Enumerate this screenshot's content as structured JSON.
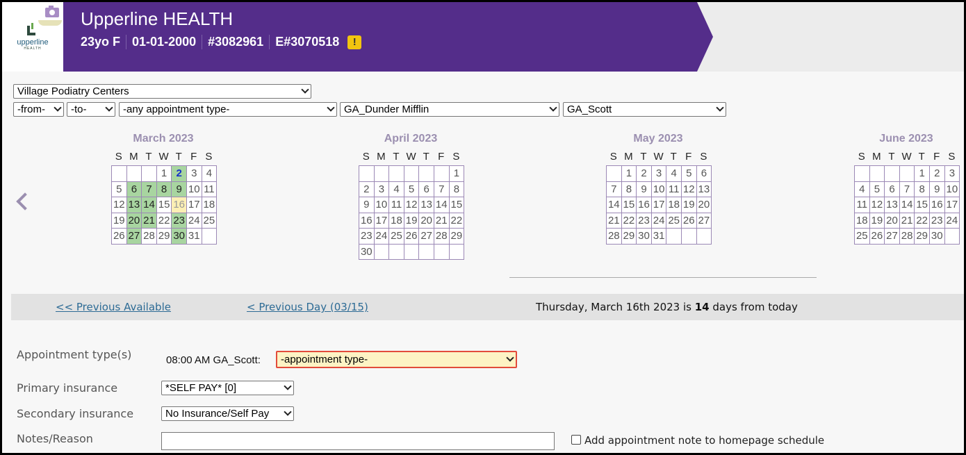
{
  "header": {
    "logo_text": "upperline",
    "logo_sub": "HEALTH",
    "title": "Upperline HEALTH",
    "patient": {
      "age_sex": "23yo F",
      "dob": "01-01-2000",
      "mrn": "#3082961",
      "enterprise_id": "E#3070518",
      "alert": "!"
    }
  },
  "filters": {
    "practice": "Village Podiatry Centers",
    "from": "-from-",
    "to": "-to-",
    "appointment_type": "-any appointment type-",
    "department": "GA_Dunder Mifflin",
    "provider": "GA_Scott"
  },
  "calendar": {
    "dow": [
      "S",
      "M",
      "T",
      "W",
      "T",
      "F",
      "S"
    ],
    "months": [
      {
        "title": "March 2023",
        "weeks": [
          [
            "",
            "",
            "",
            "1",
            "2",
            "3",
            "4"
          ],
          [
            "5",
            "6",
            "7",
            "8",
            "9",
            "10",
            "11"
          ],
          [
            "12",
            "13",
            "14",
            "15",
            "16",
            "17",
            "18"
          ],
          [
            "19",
            "20",
            "21",
            "22",
            "23",
            "24",
            "25"
          ],
          [
            "26",
            "27",
            "28",
            "29",
            "30",
            "31",
            ""
          ]
        ],
        "available": [
          "6",
          "7",
          "8",
          "9",
          "13",
          "14",
          "20",
          "21",
          "23",
          "27",
          "30"
        ],
        "today": "2",
        "selected": "16"
      },
      {
        "title": "April 2023",
        "weeks": [
          [
            "",
            "",
            "",
            "",
            "",
            "",
            "1"
          ],
          [
            "2",
            "3",
            "4",
            "5",
            "6",
            "7",
            "8"
          ],
          [
            "9",
            "10",
            "11",
            "12",
            "13",
            "14",
            "15"
          ],
          [
            "16",
            "17",
            "18",
            "19",
            "20",
            "21",
            "22"
          ],
          [
            "23",
            "24",
            "25",
            "26",
            "27",
            "28",
            "29"
          ],
          [
            "30",
            "",
            "",
            "",
            "",
            "",
            ""
          ]
        ],
        "available": [],
        "today": "",
        "selected": ""
      },
      {
        "title": "May 2023",
        "weeks": [
          [
            "",
            "1",
            "2",
            "3",
            "4",
            "5",
            "6"
          ],
          [
            "7",
            "8",
            "9",
            "10",
            "11",
            "12",
            "13"
          ],
          [
            "14",
            "15",
            "16",
            "17",
            "18",
            "19",
            "20"
          ],
          [
            "21",
            "22",
            "23",
            "24",
            "25",
            "26",
            "27"
          ],
          [
            "28",
            "29",
            "30",
            "31",
            "",
            "",
            ""
          ]
        ],
        "available": [],
        "today": "",
        "selected": ""
      },
      {
        "title": "June 2023",
        "weeks": [
          [
            "",
            "",
            "",
            "",
            "1",
            "2",
            "3"
          ],
          [
            "4",
            "5",
            "6",
            "7",
            "8",
            "9",
            "10"
          ],
          [
            "11",
            "12",
            "13",
            "14",
            "15",
            "16",
            "17"
          ],
          [
            "18",
            "19",
            "20",
            "21",
            "22",
            "23",
            "24"
          ],
          [
            "25",
            "26",
            "27",
            "28",
            "29",
            "30",
            ""
          ]
        ],
        "available": [],
        "today": "",
        "selected": ""
      }
    ]
  },
  "day_nav": {
    "previous_available": "<< Previous Available",
    "previous_day": "< Previous Day (03/15)",
    "date_text_prefix": "Thursday, March 16th 2023 is ",
    "days_count": "14",
    "date_text_suffix": " days from today"
  },
  "form": {
    "appointment_types_label": "Appointment type(s)",
    "slot_label": "08:00 AM GA_Scott:",
    "appointment_type_value": "-appointment type-",
    "primary_insurance_label": "Primary insurance",
    "primary_insurance_value": "*SELF PAY* [0]",
    "secondary_insurance_label": "Secondary insurance",
    "secondary_insurance_value": "No Insurance/Self Pay",
    "notes_label": "Notes/Reason",
    "notes_value": "",
    "homepage_note_label": "Add appointment note to homepage schedule"
  }
}
